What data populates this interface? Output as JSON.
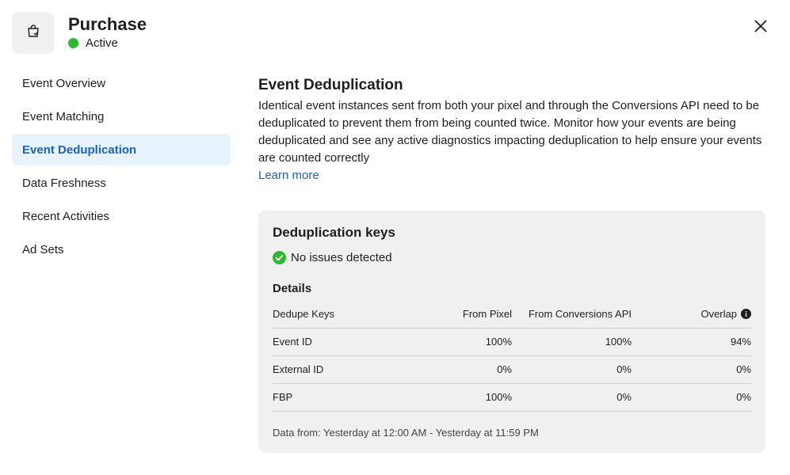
{
  "header": {
    "title": "Purchase",
    "status": "Active",
    "status_color": "#2eb82e",
    "icon": "shopping-bag-icon"
  },
  "sidebar": {
    "items": [
      {
        "label": "Event Overview",
        "active": false
      },
      {
        "label": "Event Matching",
        "active": false
      },
      {
        "label": "Event Deduplication",
        "active": true
      },
      {
        "label": "Data Freshness",
        "active": false
      },
      {
        "label": "Recent Activities",
        "active": false
      },
      {
        "label": "Ad Sets",
        "active": false
      }
    ]
  },
  "main": {
    "title": "Event Deduplication",
    "description": "Identical event instances sent from both your pixel and through the Conversions API need to be deduplicated to prevent them from being counted twice. Monitor how your events are being deduplicated and see any active diagnostics impacting deduplication to help ensure your events are counted correctly",
    "learn_more": "Learn more",
    "link_color": "#1b62c4"
  },
  "card": {
    "title": "Deduplication keys",
    "status": "No issues detected",
    "details_label": "Details",
    "table": {
      "headers": [
        "Dedupe Keys",
        "From Pixel",
        "From Conversions API",
        "Overlap"
      ],
      "rows": [
        [
          "Event ID",
          "100%",
          "100%",
          "94%"
        ],
        [
          "External ID",
          "0%",
          "0%",
          "0%"
        ],
        [
          "FBP",
          "100%",
          "0%",
          "0%"
        ]
      ]
    },
    "data_from": "Data from: Yesterday at 12:00 AM - Yesterday at 11:59 PM"
  }
}
